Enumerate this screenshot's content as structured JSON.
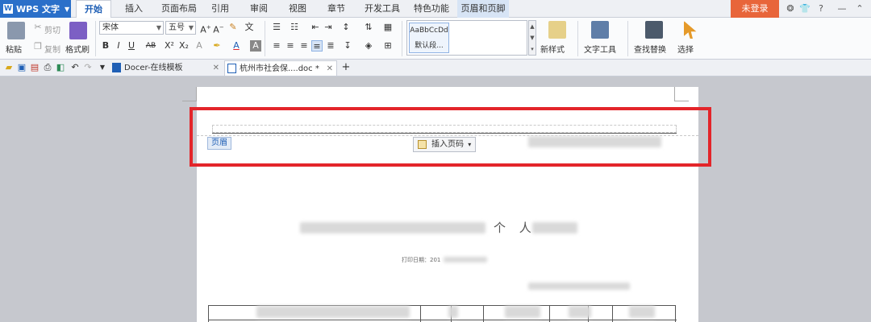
{
  "app": {
    "name": "WPS 文字",
    "logo": "W"
  },
  "menu_tabs": [
    "开始",
    "插入",
    "页面布局",
    "引用",
    "审阅",
    "视图",
    "章节",
    "开发工具",
    "特色功能",
    "页眉和页脚"
  ],
  "active_tab": "开始",
  "login_label": "未登录",
  "title_icons": [
    "skin-icon",
    "shirt-icon",
    "help-icon",
    "minimize-icon",
    "collapse-icon"
  ],
  "title_icon_glyphs": [
    "❂",
    "👕",
    "?",
    "—",
    "⌃"
  ],
  "ribbon": {
    "paste": "粘贴",
    "cut": "剪切",
    "copy": "复制",
    "format_painter": "格式刷",
    "font_name": "宋体",
    "font_size": "五号",
    "bold": "B",
    "italic": "I",
    "underline": "U",
    "strike": "AB",
    "superscript": "X²",
    "subscript": "X₂",
    "style_preview": "AaBbCcDd",
    "style_name": "默认段...",
    "new_style": "新样式",
    "text_tools": "文字工具",
    "find_replace": "查找替换",
    "select": "选择"
  },
  "doc_tabs": [
    {
      "label": "Docer-在线模板",
      "active": false
    },
    {
      "label": "杭州市社会保....doc *",
      "active": true
    }
  ],
  "add_tab_symbol": "+",
  "header": {
    "label": "页眉",
    "insert_page_button": "插入页码"
  },
  "document": {
    "title_visible_fragment": "个 人",
    "date_label": "打印日期：201"
  }
}
